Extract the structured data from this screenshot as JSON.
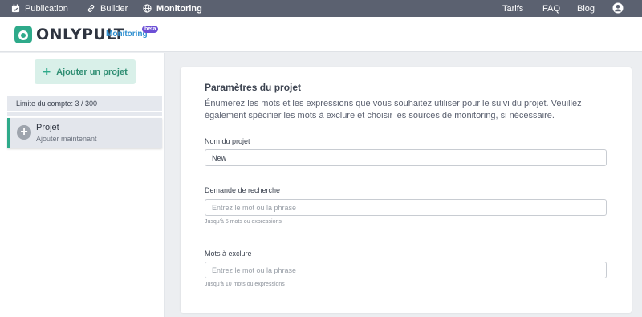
{
  "topnav": {
    "publication": "Publication",
    "builder": "Builder",
    "monitoring": "Monitoring",
    "tarifs": "Tarifs",
    "faq": "FAQ",
    "blog": "Blog"
  },
  "header": {
    "logo": "ONLYPULT",
    "product": "Monitoring",
    "badge": "beta"
  },
  "sidebar": {
    "add_project": "Ajouter un projet",
    "limit": "Limite du compte: 3 / 300",
    "project": {
      "title": "Projet",
      "subtitle": "Ajouter maintenant"
    }
  },
  "main": {
    "title": "Paramètres du projet",
    "description": "Énumérez les mots et les expressions que vous souhaitez utiliser pour le suivi du projet. Veuillez également spécifier les mots à exclure et choisir les sources de monitoring, si nécessaire.",
    "name_label": "Nom du projet",
    "name_value": "New",
    "search_label": "Demande de recherche",
    "search_placeholder": "Entrez le mot ou la phrase",
    "search_hint": "Jusqu'à 5 mots ou expressions",
    "exclude_label": "Mots à exclure",
    "exclude_placeholder": "Entrez le mot ou la phrase",
    "exclude_hint": "Jusqu'à 10 mots ou expressions"
  },
  "colors": {
    "accent": "#2eaa8a",
    "nav": "#5b6170",
    "beta": "#6c4fd6"
  }
}
